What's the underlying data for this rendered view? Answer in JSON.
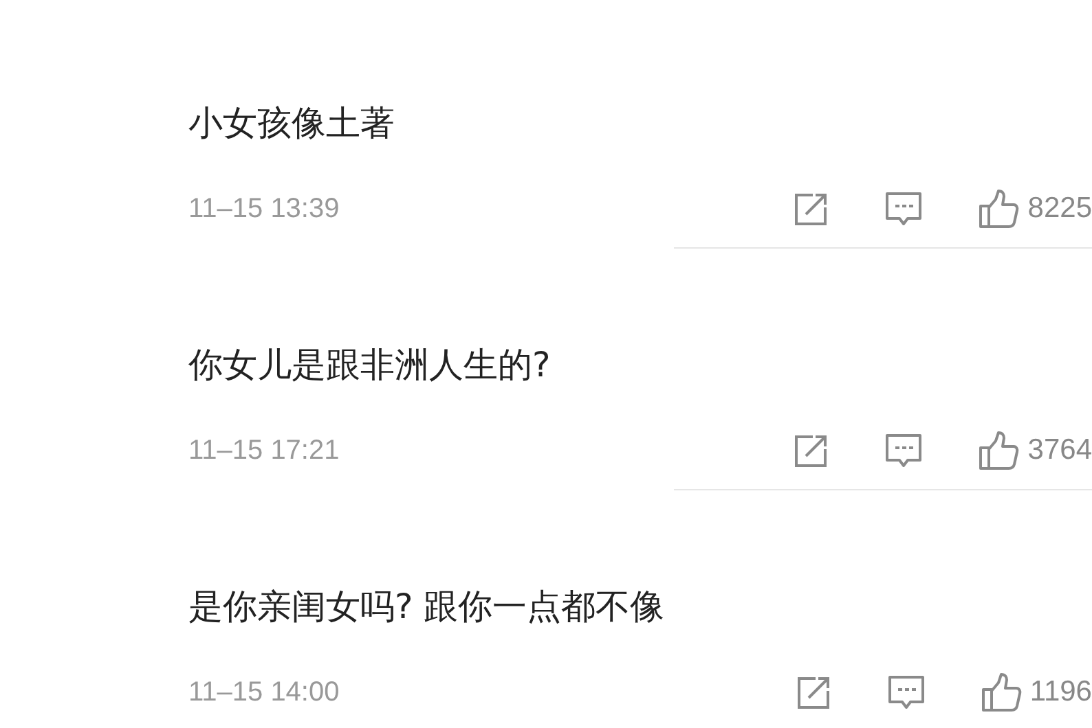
{
  "comments": [
    {
      "text": "小女孩像土著",
      "time": "11–15 13:39",
      "likes": "8225"
    },
    {
      "text": "你女儿是跟非洲人生的?",
      "time": "11–15 17:21",
      "likes": "3764"
    },
    {
      "text": "是你亲闺女吗? 跟你一点都不像",
      "time": "11–15 14:00",
      "likes": "1196"
    }
  ]
}
